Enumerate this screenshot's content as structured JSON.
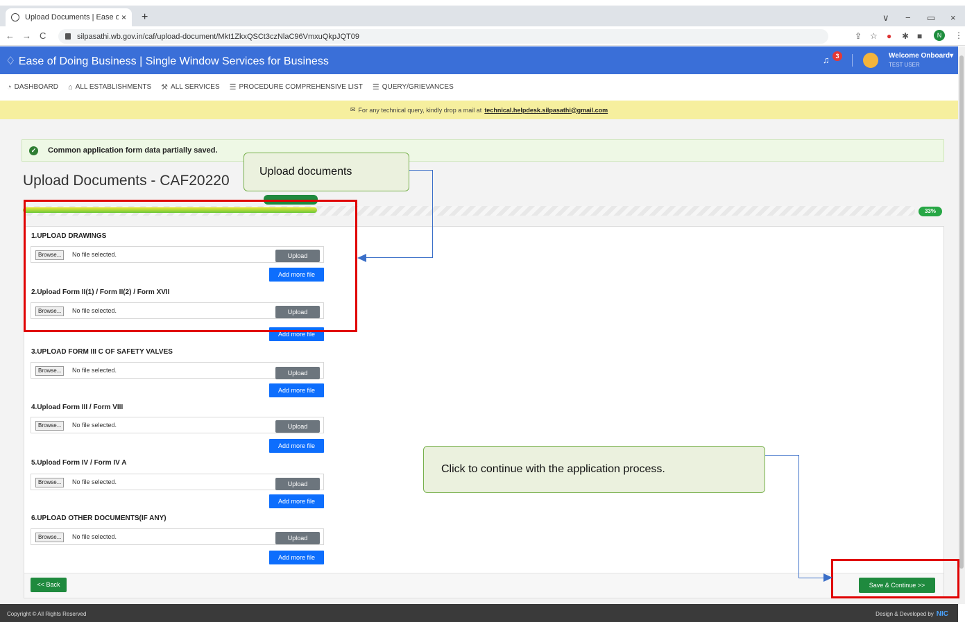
{
  "browser": {
    "tab_title": "Upload Documents | Ease of doi",
    "tab_close": "×",
    "new_tab": "+",
    "url": "silpasathi.wb.gov.in/caf/upload-document/Mkt1ZkxQSCt3czNlaC96VmxuQkpJQT09",
    "nav_back": "←",
    "nav_forward": "→",
    "nav_reload": "C",
    "profile_initial": "N",
    "win_minimize_chevron": "∨",
    "win_minimize": "−",
    "win_restore": "▭",
    "win_close": "×"
  },
  "header": {
    "title": "Ease of Doing Business | Single Window Services for Business",
    "notification_count": "3",
    "welcome": "Welcome Onboard",
    "user": "TEST USER",
    "colors": {
      "bar": "#3a6fd8"
    }
  },
  "menu": {
    "items": [
      {
        "label": "DASHBOARD",
        "icon": "dashboard-icon"
      },
      {
        "label": "ALL ESTABLISHMENTS",
        "icon": "building-icon"
      },
      {
        "label": "ALL SERVICES",
        "icon": "wrench-icon"
      },
      {
        "label": "PROCEDURE COMPREHENSIVE LIST",
        "icon": "list-icon"
      },
      {
        "label": "QUERY/GRIEVANCES",
        "icon": "list-icon"
      }
    ]
  },
  "notice": {
    "text": "For any technical query, kindly drop a mail at",
    "email": "technical.helpdesk.silpasathi@gmail.com"
  },
  "alert": {
    "text": "Common application form data partially saved."
  },
  "page": {
    "title": "Upload Documents - CAF20220",
    "progress_percent": 33,
    "progress_label": "33%"
  },
  "sections": [
    {
      "title": "1.UPLOAD DRAWINGS"
    },
    {
      "title": "2.Upload Form II(1) / Form II(2) / Form XVII"
    },
    {
      "title": "3.UPLOAD FORM III C OF SAFETY VALVES"
    },
    {
      "title": "4.Upload Form III / Form VIII"
    },
    {
      "title": "5.Upload Form IV / Form IV A"
    },
    {
      "title": "6.UPLOAD OTHER DOCUMENTS(IF ANY)"
    }
  ],
  "upload_row": {
    "browse_label": "Browse...",
    "no_file": "No file selected.",
    "upload_label": "Upload",
    "add_more_label": "Add more file"
  },
  "actions": {
    "back": "<< Back",
    "save": "Save & Continue >>"
  },
  "footer": {
    "copyright": "Copyright © All Rights Reserved",
    "credit": "Design & Developed by",
    "logo": "NIC"
  },
  "annotations": {
    "callout_upload": "Upload documents",
    "callout_continue": "Click to continue with the application process.",
    "colors": {
      "box": "#e00000",
      "callout_fill": "#ebf1de",
      "connector": "#3b6fc8"
    }
  }
}
